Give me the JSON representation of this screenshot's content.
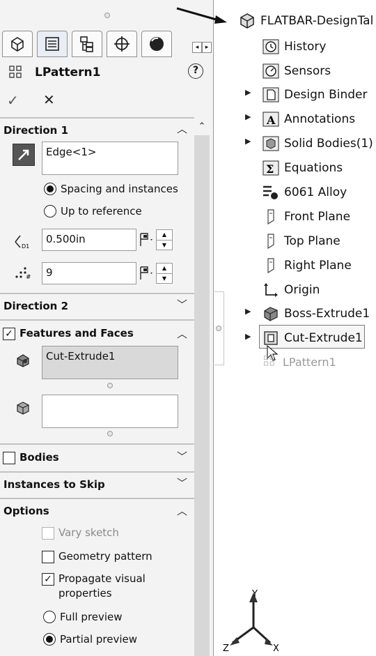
{
  "property_manager": {
    "title": "LPattern1",
    "help": "?",
    "ok": "✓",
    "cancel": "✕",
    "tabs": [
      "feature-manager-tab",
      "property-manager-tab",
      "configuration-manager-tab",
      "dimxpert-tab",
      "display-manager-tab"
    ],
    "direction1": {
      "header": "Direction 1",
      "edge_value": "Edge<1>",
      "radio_spacing": "Spacing and instances",
      "radio_reference": "Up to reference",
      "spacing_value": "0.500in",
      "instances_value": "9",
      "spacing_icon_label": "D1",
      "instances_icon_label": "#"
    },
    "direction2": {
      "header": "Direction 2"
    },
    "features_faces": {
      "header": "Features and Faces",
      "feature_value": "Cut-Extrude1",
      "face_value": ""
    },
    "bodies": {
      "header": "Bodies"
    },
    "instances_to_skip": {
      "header": "Instances to Skip"
    },
    "options": {
      "header": "Options",
      "vary_sketch": "Vary sketch",
      "geometry_pattern": "Geometry pattern",
      "propagate_line1": "Propagate visual",
      "propagate_line2": "properties",
      "full_preview": "Full preview",
      "partial_preview": "Partial preview"
    }
  },
  "feature_tree": {
    "root": "FLATBAR-DesignTal",
    "items": [
      {
        "label": "History",
        "icon": "history-icon"
      },
      {
        "label": "Sensors",
        "icon": "sensors-icon"
      },
      {
        "label": "Design Binder",
        "icon": "design-binder-icon"
      },
      {
        "label": "Annotations",
        "icon": "annotations-icon"
      },
      {
        "label": "Solid Bodies(1)",
        "icon": "solid-bodies-icon"
      },
      {
        "label": "Equations",
        "icon": "equations-icon"
      },
      {
        "label": "6061 Alloy",
        "icon": "material-icon"
      },
      {
        "label": "Front Plane",
        "icon": "plane-icon"
      },
      {
        "label": "Top Plane",
        "icon": "plane-icon"
      },
      {
        "label": "Right Plane",
        "icon": "plane-icon"
      },
      {
        "label": "Origin",
        "icon": "origin-icon"
      },
      {
        "label": "Boss-Extrude1",
        "icon": "boss-extrude-icon"
      },
      {
        "label": "Cut-Extrude1",
        "icon": "cut-extrude-icon"
      },
      {
        "label": "LPattern1",
        "icon": "linear-pattern-icon"
      }
    ],
    "axis": {
      "y": "Y",
      "z": "Z",
      "x": "X"
    }
  }
}
